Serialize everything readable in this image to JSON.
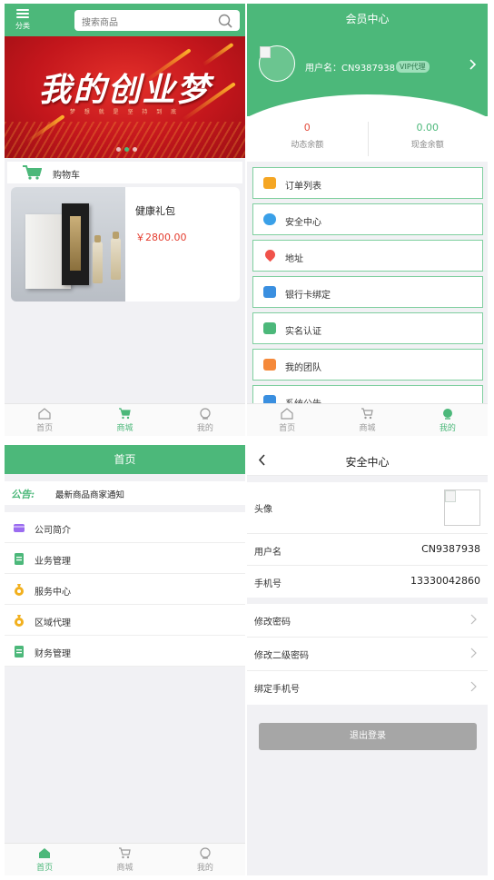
{
  "shop": {
    "category_label": "分类",
    "search_placeholder": "搜索商品",
    "banner_title": "我的创业梦",
    "banner_subtitle": "梦 想 就 是 坚 持 到 底",
    "cart_label": "购物车",
    "product": {
      "name": "健康礼包",
      "price": "￥2800.00"
    },
    "nav": [
      {
        "label": "首页",
        "icon": "home-outline-icon",
        "active": false
      },
      {
        "label": "商城",
        "icon": "cart-icon",
        "active": true
      },
      {
        "label": "我的",
        "icon": "user-outline-icon",
        "active": false
      }
    ]
  },
  "member": {
    "title": "会员中心",
    "username": "用户名：CN9387938",
    "vip_badge": "VIP代理",
    "dynamic_balance": {
      "value": "0",
      "label": "动态余额"
    },
    "cash_balance": {
      "value": "0.00",
      "label": "现金余额"
    },
    "menu": [
      {
        "label": "订单列表",
        "icon": "order-icon",
        "color": "#f5a623"
      },
      {
        "label": "安全中心",
        "icon": "cloud-icon",
        "color": "#3aa0e8"
      },
      {
        "label": "地址",
        "icon": "location-pin-icon",
        "color": "#f0524a"
      },
      {
        "label": "银行卡绑定",
        "icon": "wallet-icon",
        "color": "#3a8fe0"
      },
      {
        "label": "实名认证",
        "icon": "id-card-icon",
        "color": "#4cb87a"
      },
      {
        "label": "我的团队",
        "icon": "plus-icon",
        "color": "#f5893a"
      },
      {
        "label": "系统公告",
        "icon": "notice-icon",
        "color": "#3a8fe0"
      }
    ],
    "nav": [
      {
        "label": "首页",
        "icon": "home-outline-icon",
        "active": false
      },
      {
        "label": "商城",
        "icon": "cart-icon",
        "active": false
      },
      {
        "label": "我的",
        "icon": "user-filled-icon",
        "active": true
      }
    ]
  },
  "home": {
    "title": "首页",
    "notice_tag": "公告:",
    "notice_text": "最新商品商家通知",
    "menu": [
      {
        "label": "公司简介",
        "icon": "card-icon",
        "color": "#9b6cf0"
      },
      {
        "label": "业务管理",
        "icon": "clipboard-icon",
        "color": "#4cb87a"
      },
      {
        "label": "服务中心",
        "icon": "money-bag-icon",
        "color": "#f2b01e"
      },
      {
        "label": "区域代理",
        "icon": "money-bag-icon",
        "color": "#f2b01e"
      },
      {
        "label": "财务管理",
        "icon": "clipboard-icon",
        "color": "#4cb87a"
      }
    ],
    "nav": [
      {
        "label": "首页",
        "icon": "home-filled-icon",
        "active": true
      },
      {
        "label": "商城",
        "icon": "cart-icon",
        "active": false
      },
      {
        "label": "我的",
        "icon": "user-outline-icon",
        "active": false
      }
    ]
  },
  "security": {
    "title": "安全中心",
    "avatar_label": "头像",
    "username_label": "用户名",
    "username_value": "CN9387938",
    "phone_label": "手机号",
    "phone_value": "13330042860",
    "links": [
      {
        "label": "修改密码"
      },
      {
        "label": "修改二级密码"
      },
      {
        "label": "绑定手机号"
      }
    ],
    "logout_label": "退出登录"
  },
  "colors": {
    "brand_green": "#4cb87a",
    "price_red": "#e43c2e",
    "button_gray": "#a6a6a6"
  }
}
